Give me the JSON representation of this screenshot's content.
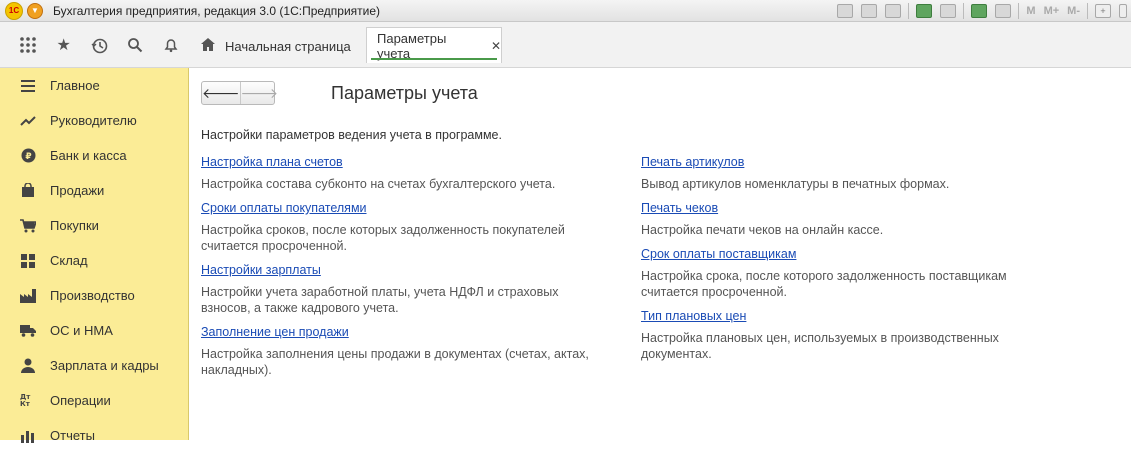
{
  "titlebar": {
    "logo_text": "1С",
    "title": "Бухгалтерия предприятия, редакция 3.0  (1С:Предприятие)",
    "memory_labels": [
      "M",
      "M+",
      "M-"
    ]
  },
  "nav": {
    "home_tab": "Начальная страница",
    "active_tab": "Параметры учета"
  },
  "sidebar": {
    "items": [
      {
        "label": "Главное",
        "icon": "menu-lines-icon"
      },
      {
        "label": "Руководителю",
        "icon": "trend-icon"
      },
      {
        "label": "Банк и касса",
        "icon": "ruble-coin-icon"
      },
      {
        "label": "Продажи",
        "icon": "shopping-bag-icon"
      },
      {
        "label": "Покупки",
        "icon": "cart-icon"
      },
      {
        "label": "Склад",
        "icon": "warehouse-grid-icon"
      },
      {
        "label": "Производство",
        "icon": "factory-icon"
      },
      {
        "label": "ОС и НМА",
        "icon": "truck-icon"
      },
      {
        "label": "Зарплата и кадры",
        "icon": "person-icon"
      },
      {
        "label": "Операции",
        "icon": "debit-credit-icon"
      },
      {
        "label": "Отчеты",
        "icon": "bar-chart-icon"
      }
    ],
    "debit_credit_glyph": "Дт Кт"
  },
  "main": {
    "title": "Параметры учета",
    "intro": "Настройки параметров ведения учета в программе.",
    "left_column": [
      {
        "link": "Настройка плана счетов",
        "desc": "Настройка состава субконто на счетах бухгалтерского учета."
      },
      {
        "link": "Сроки оплаты покупателями",
        "desc": "Настройка сроков, после которых задолженность покупателей считается просроченной."
      },
      {
        "link": "Настройки зарплаты",
        "desc": "Настройки учета заработной платы, учета НДФЛ и страховых взносов, а также кадрового учета."
      },
      {
        "link": "Заполнение цен продажи",
        "desc": "Настройка заполнения цены продажи в документах (счетах, актах, накладных)."
      }
    ],
    "right_column": [
      {
        "link": "Печать артикулов",
        "desc": "Вывод артикулов номенклатуры в печатных формах."
      },
      {
        "link": "Печать чеков",
        "desc": "Настройка печати чеков на онлайн кассе."
      },
      {
        "link": "Срок оплаты поставщикам",
        "desc": "Настройка срока, после которого задолженность поставщикам считается просроченной."
      },
      {
        "link": "Тип плановых цен",
        "desc": "Настройка плановых цен, используемых в производственных документах."
      }
    ]
  }
}
